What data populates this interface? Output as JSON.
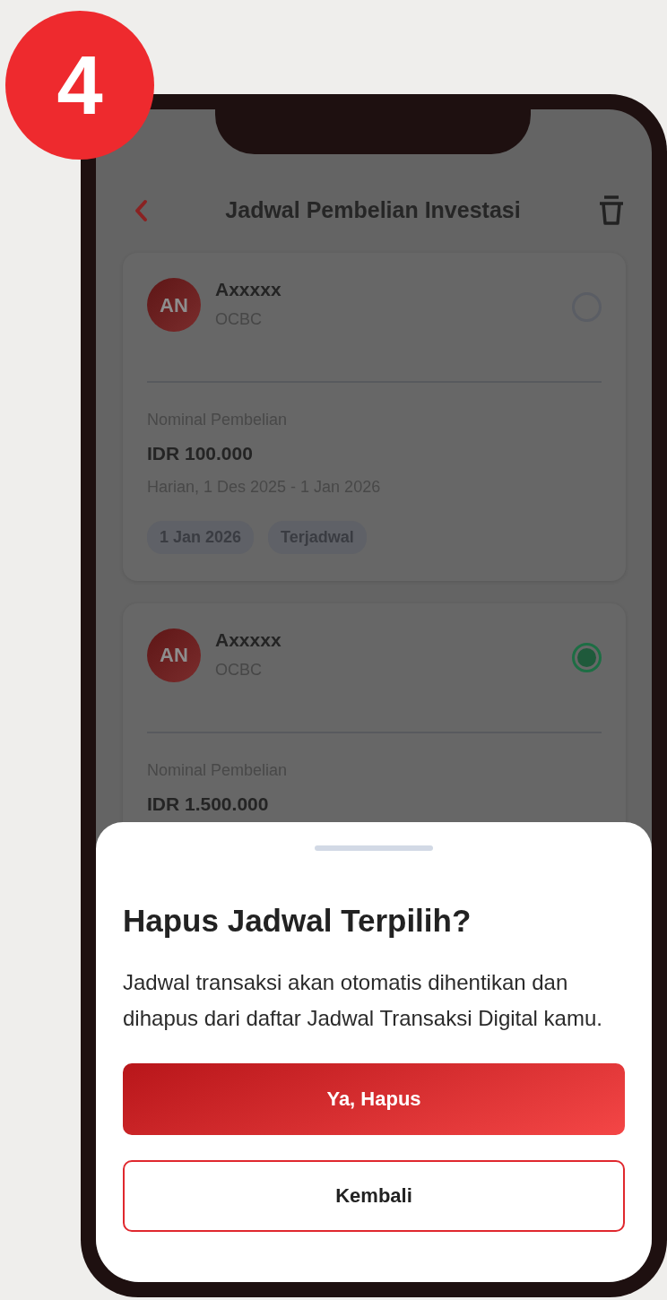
{
  "step_badge": "4",
  "header": {
    "title": "Jadwal Pembelian Investasi"
  },
  "schedules": [
    {
      "initials": "AN",
      "name": "Axxxxx",
      "bank": "OCBC",
      "amount_label": "Nominal Pembelian",
      "amount": "IDR 100.000",
      "period": "Harian, 1 Des 2025 - 1 Jan 2026",
      "tags": [
        "1 Jan 2026",
        "Terjadwal"
      ],
      "selected": false
    },
    {
      "initials": "AN",
      "name": "Axxxxx",
      "bank": "OCBC",
      "amount_label": "Nominal Pembelian",
      "amount": "IDR 1.500.000",
      "selected": true
    }
  ],
  "dialog": {
    "title": "Hapus Jadwal Terpilih?",
    "message": "Jadwal transaksi akan otomatis dihentikan dan dihapus dari daftar Jadwal Transaksi Digital kamu.",
    "buttons": [
      {
        "label": "Ya, Hapus",
        "kind": "primary"
      },
      {
        "label": "Kembali",
        "kind": "secondary"
      }
    ]
  }
}
